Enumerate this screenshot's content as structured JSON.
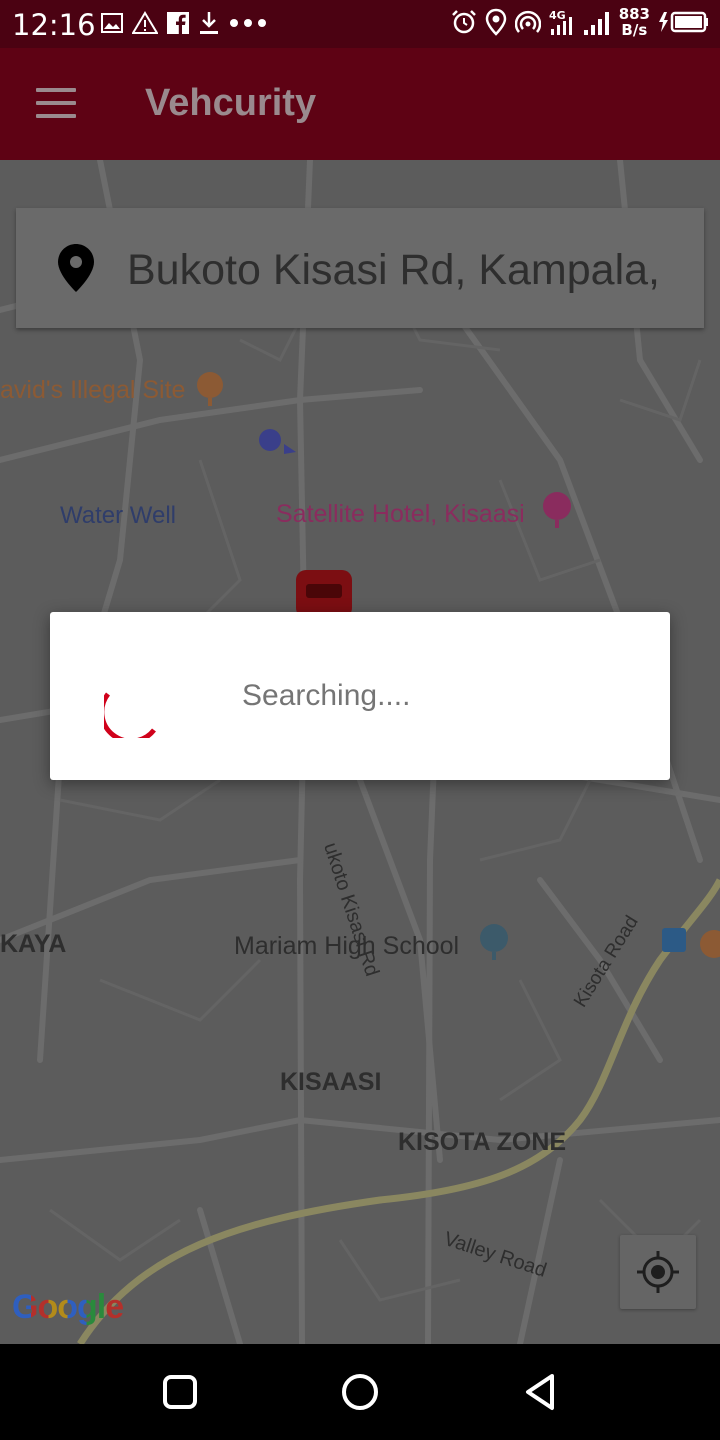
{
  "status_bar": {
    "time": "12:16",
    "network_speed_value": "883",
    "network_speed_unit": "B/s",
    "left_icons": [
      "image-icon",
      "warning-icon",
      "facebook-icon",
      "download-icon",
      "more-dots-icon"
    ],
    "right_icons": [
      "alarm-icon",
      "location-icon",
      "hotspot-icon",
      "signal-4g-icon",
      "signal-bars-icon",
      "battery-charging-icon"
    ]
  },
  "app_bar": {
    "title": "Vehcurity"
  },
  "search": {
    "address": "Bukoto Kisasi Rd, Kampala,"
  },
  "map_labels": {
    "poi_restaurant": "avid's Illegal Site",
    "water_well": "Water Well",
    "hotel": "Satellite Hotel, Kisaasi",
    "road_bukoto": "ukoto Kisasi Rd",
    "area_kaya": "KAYA",
    "school": "Mariam High School",
    "road_kisota": "Kisota Road",
    "area_kisaasi": "KISAASI",
    "area_kisota_zone": "KISOTA ZONE",
    "road_valley": "Valley Road"
  },
  "dialog": {
    "message": "Searching...."
  },
  "google_logo": "Google",
  "colors": {
    "primary": "#5e0214",
    "status_bar": "#4b0212",
    "spinner": "#d0021b"
  }
}
